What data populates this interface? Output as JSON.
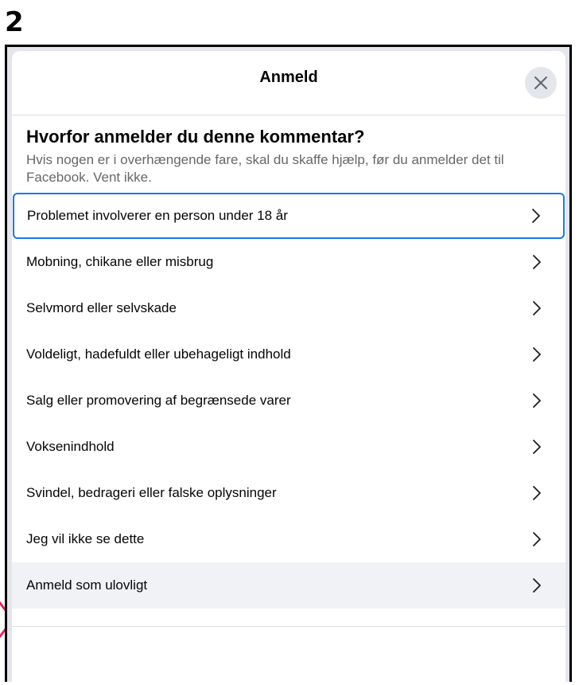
{
  "step_number": "2",
  "dialog": {
    "title": "Anmeld",
    "close_icon": "close-icon",
    "question_title": "Hvorfor anmelder du denne kommentar?",
    "question_subtitle": "Hvis nogen er i overhængende fare, skal du skaffe hjælp, før du anmelder det til Facebook. Vent ikke."
  },
  "options": [
    {
      "label": "Problemet involverer en person under 18 år",
      "state": "focused"
    },
    {
      "label": "Mobning, chikane eller misbrug",
      "state": "normal"
    },
    {
      "label": "Selvmord eller selvskade",
      "state": "normal"
    },
    {
      "label": "Voldeligt, hadefuldt eller ubehageligt indhold",
      "state": "normal"
    },
    {
      "label": "Salg eller promovering af begrænsede varer",
      "state": "normal"
    },
    {
      "label": "Voksenindhold",
      "state": "normal"
    },
    {
      "label": "Svindel, bedrageri eller falske oplysninger",
      "state": "normal"
    },
    {
      "label": "Jeg vil ikke se dette",
      "state": "normal"
    },
    {
      "label": "Anmeld som ulovligt",
      "state": "highlighted"
    }
  ],
  "colors": {
    "focus_border": "#1877f2",
    "pointer_arrow": "#e0245e",
    "highlight_bg": "#f0f2f5"
  }
}
